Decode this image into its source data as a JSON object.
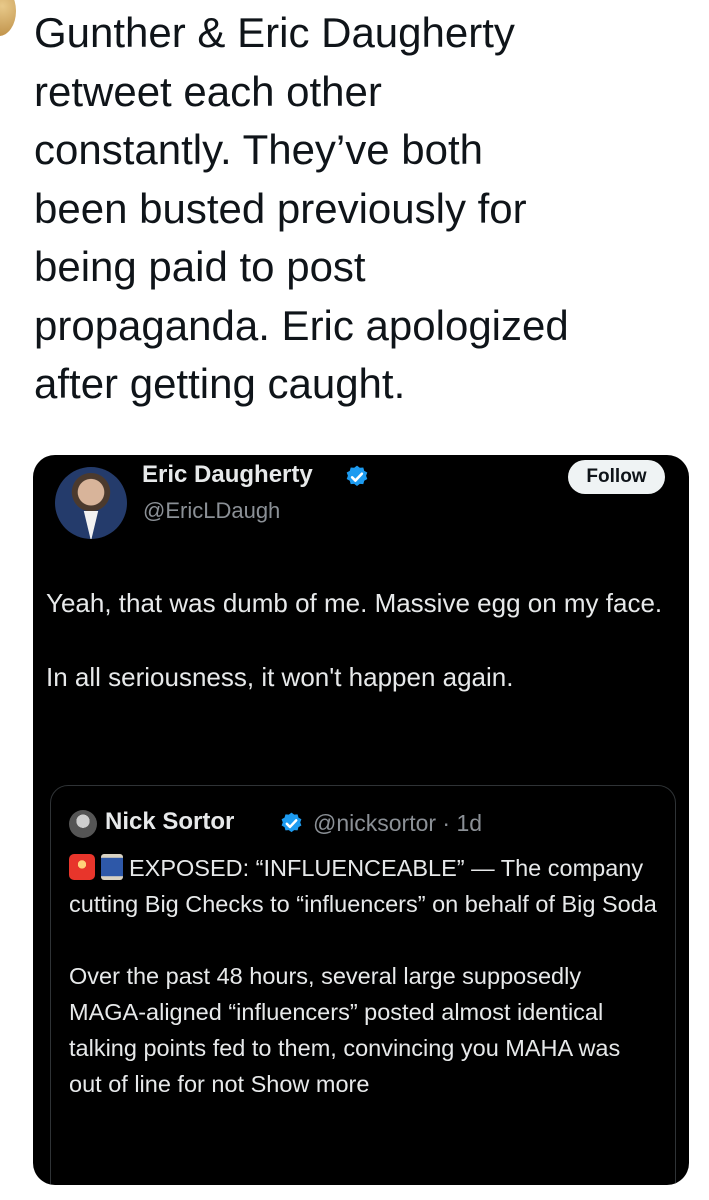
{
  "post": {
    "text": "Gunther & Eric Daugherty\nretweet each other\nconstantly.  They’ve both\nbeen busted previously for\nbeing paid to post\npropaganda.  Eric apologized\nafter getting caught."
  },
  "embedded_tweet": {
    "author_name": "Eric Daugherty",
    "author_handle": "@EricLDaugh",
    "follow_label": "Follow",
    "body_lines": [
      "Yeah, that was dumb of me. Massive egg on my face.",
      "In all seriousness, it won't happen again."
    ],
    "quote": {
      "author_name": "Nick Sortor",
      "handle_time": "@nicksortor · 1d",
      "headline": "EXPOSED: “INFLUENCEABLE” — The company cutting Big Checks to “influencers” on behalf of Big Soda",
      "paragraph": "Over the past 48 hours, several large supposedly MAGA-aligned “influencers” posted almost identical talking points fed to them, convincing you MAHA was out of line for not",
      "show_more": "Show more"
    }
  },
  "icons": [
    "verified-badge-icon",
    "siren-emoji-icon",
    "thread-spool-emoji-icon"
  ],
  "colors": {
    "card_bg": "#000000",
    "verified_blue": "#1d9bf0",
    "muted_text": "#8b9096"
  }
}
